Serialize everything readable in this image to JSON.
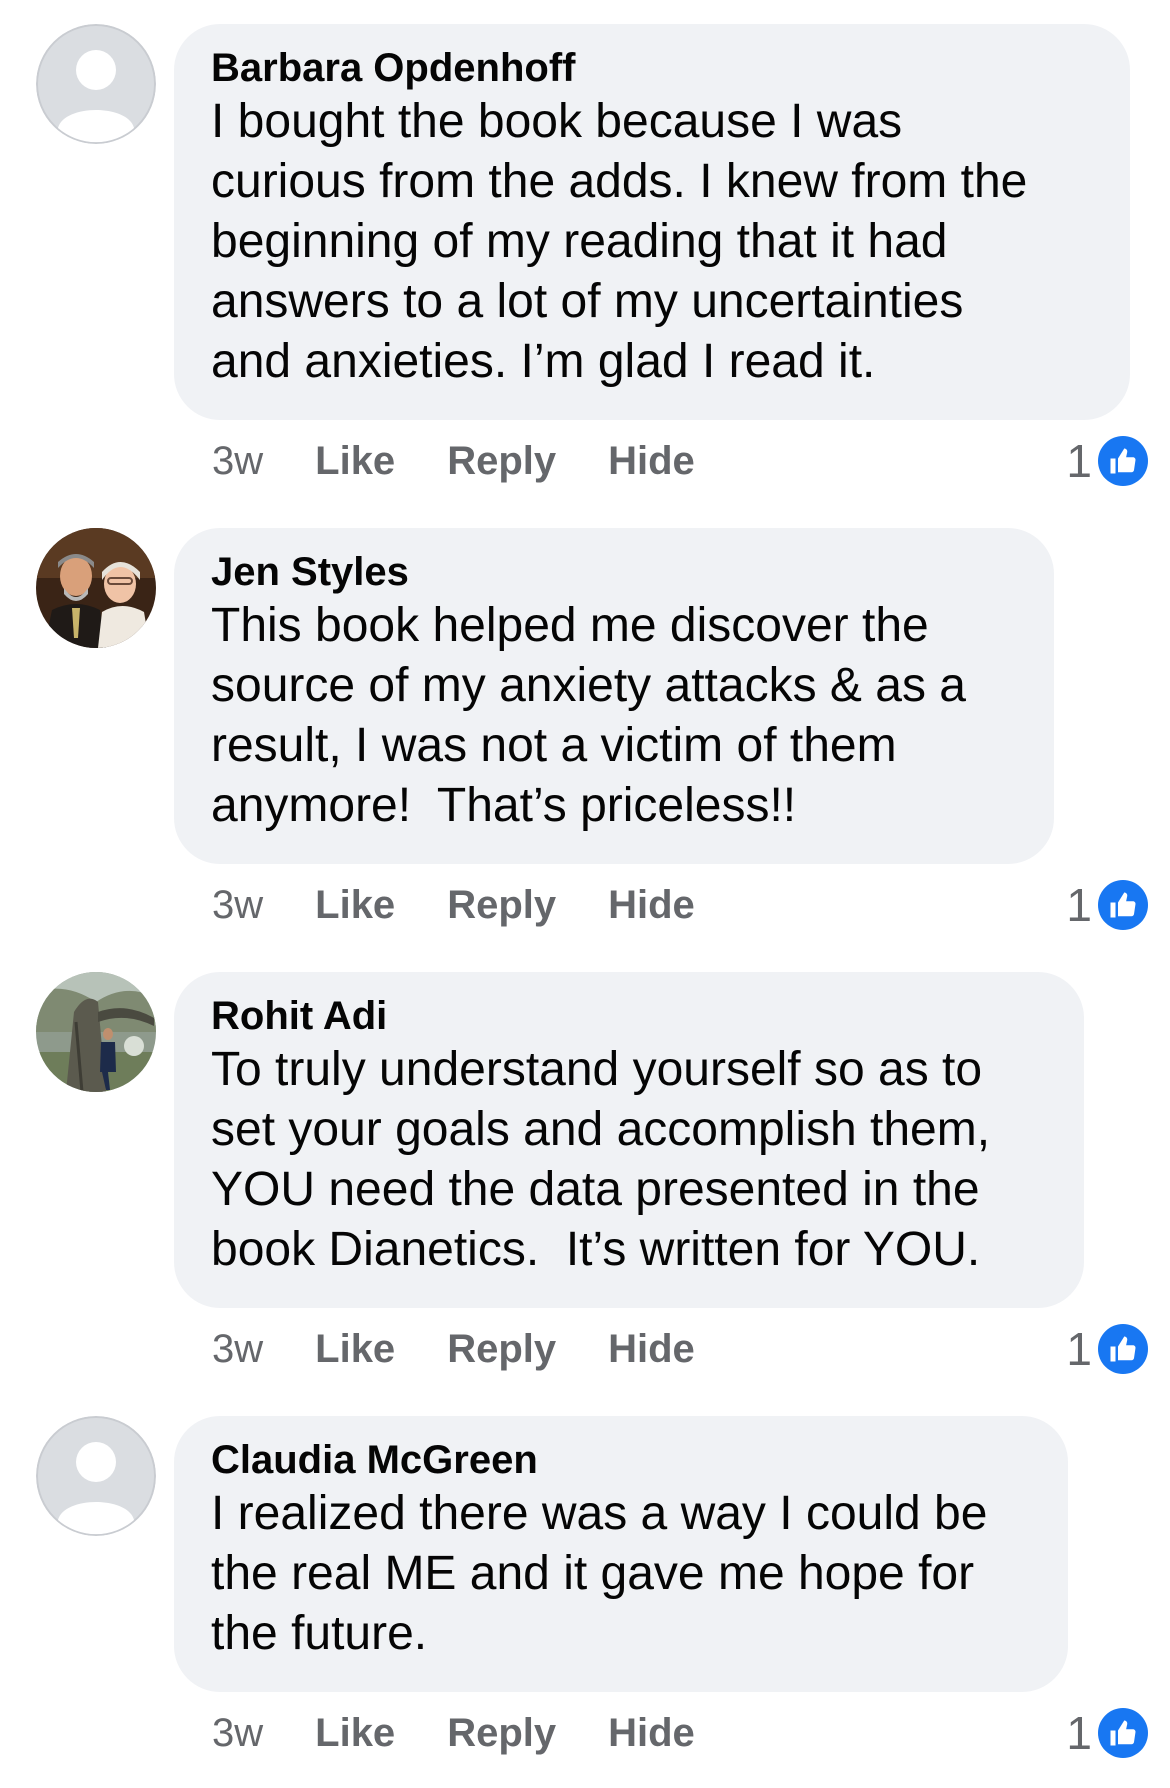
{
  "comments": [
    {
      "author": "Barbara Opdenhoff",
      "text": "I bought the book because I was\ncurious from the adds. I knew from the\nbeginning of my reading that it had\nanswers to a lot of my uncertainties\nand anxieties. I’m glad I read it.",
      "time": "3w",
      "like_label": "Like",
      "reply_label": "Reply",
      "hide_label": "Hide",
      "reaction_count": "1",
      "avatar": "default-avatar"
    },
    {
      "author": "Jen Styles",
      "text": "This book helped me discover the\nsource of my anxiety attacks & as a\nresult, I was not a victim of them\nanymore!  That’s priceless!!",
      "time": "3w",
      "like_label": "Like",
      "reply_label": "Reply",
      "hide_label": "Hide",
      "reaction_count": "1",
      "avatar": "photo-couple"
    },
    {
      "author": "Rohit Adi",
      "text": "To truly understand yourself so as to\nset your goals and accomplish them,\nYOU need the data presented in the\nbook Dianetics.  It’s written for YOU.",
      "time": "3w",
      "like_label": "Like",
      "reply_label": "Reply",
      "hide_label": "Hide",
      "reaction_count": "1",
      "avatar": "photo-tree"
    },
    {
      "author": "Claudia McGreen",
      "text": "I realized there was a way I could be\nthe real ME and it gave me hope for\nthe future.",
      "time": "3w",
      "like_label": "Like",
      "reply_label": "Reply",
      "hide_label": "Hide",
      "reaction_count": "1",
      "avatar": "default-avatar"
    }
  ],
  "colors": {
    "bubble": "#f0f2f5",
    "secondary_text": "#65676b",
    "like_blue": "#1877f2"
  }
}
